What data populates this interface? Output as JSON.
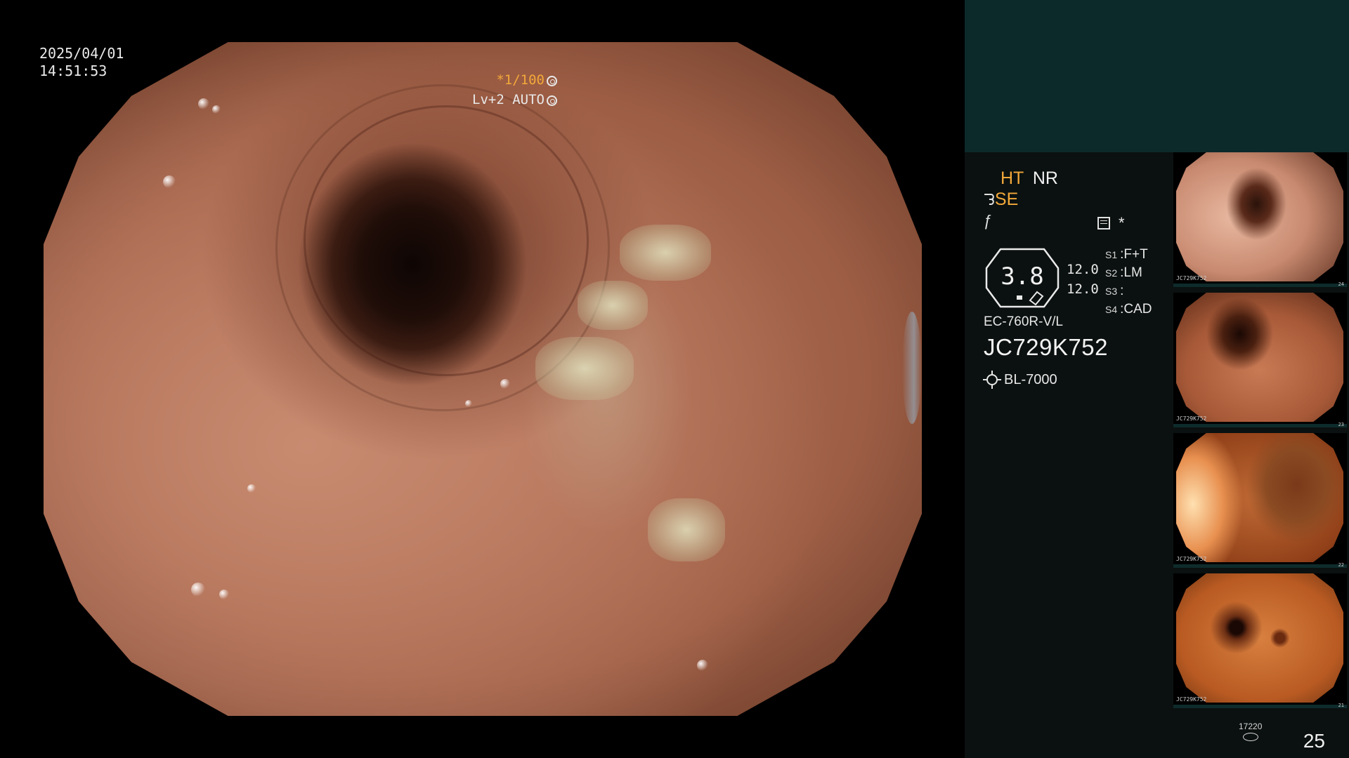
{
  "header": {
    "date": "2025/04/01",
    "time": "14:51:53"
  },
  "capture": {
    "shutter": "*1/100",
    "level_mode": "Lv+2 AUTO"
  },
  "panel": {
    "ht_label": "HT",
    "nr_label": "NR",
    "se_label": "SE",
    "se_glyph": "ᘊ",
    "filter_glyph": "ƒ",
    "star_glyph": "*",
    "zoom_value": "3.8",
    "metric_1": "12.0",
    "metric_2": "12.0",
    "switches": [
      {
        "key": "S1",
        "value": "F+T"
      },
      {
        "key": "S2",
        "value": "LM"
      },
      {
        "key": "S3",
        "value": ""
      },
      {
        "key": "S4",
        "value": "CAD"
      }
    ],
    "scope_model": "EC-760R-V/L",
    "scope_serial": "JC729K752",
    "light_source": "BL-7000"
  },
  "thumbnails": [
    {
      "id": "JC729K752",
      "num": "24"
    },
    {
      "id": "JC729K752",
      "num": "23"
    },
    {
      "id": "JC729K752",
      "num": "22"
    },
    {
      "id": "JC729K752",
      "num": "21"
    }
  ],
  "footer": {
    "storage_count": "17220",
    "image_count": "25"
  },
  "colors": {
    "accent_orange": "#f2a83a",
    "panel_teal": "#0d2a2a"
  }
}
